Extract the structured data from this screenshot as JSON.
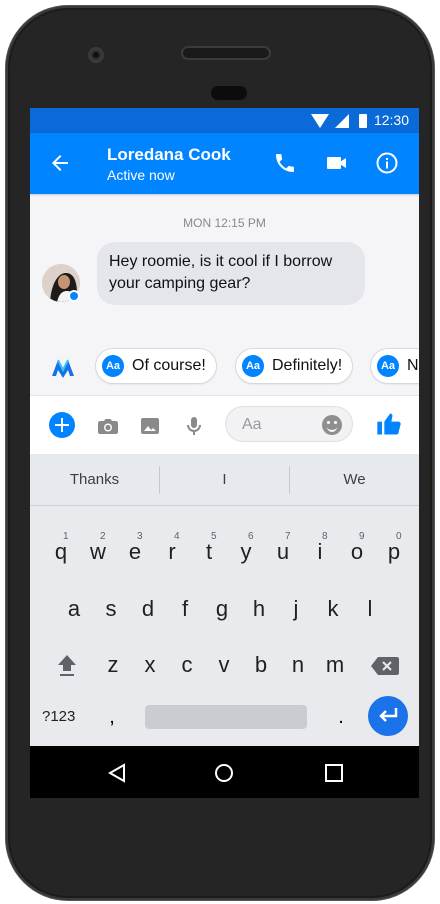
{
  "status_bar": {
    "time": "12:30"
  },
  "app_bar": {
    "contact_name": "Loredana Cook",
    "contact_status": "Active now",
    "icons": [
      "back-arrow-icon",
      "phone-call-icon",
      "video-call-icon",
      "info-icon"
    ]
  },
  "conversation": {
    "timestamp": "MON 12:15 PM",
    "messages": [
      {
        "text": "Hey roomie, is it cool if I borrow your camping gear?"
      }
    ]
  },
  "suggestions": {
    "items": [
      {
        "icon_label": "Aa",
        "text": "Of course!"
      },
      {
        "icon_label": "Aa",
        "text": "Definitely!"
      },
      {
        "icon_label": "Aa",
        "text": "N"
      }
    ]
  },
  "composer": {
    "placeholder": "Aa",
    "icons": [
      "add-icon",
      "camera-icon",
      "gallery-icon",
      "microphone-icon",
      "emoji-icon",
      "thumbs-up-icon"
    ]
  },
  "keyboard": {
    "predictions": [
      "Thanks",
      "I",
      "We"
    ],
    "rows": {
      "row1_letters": [
        "q",
        "w",
        "e",
        "r",
        "t",
        "y",
        "u",
        "i",
        "o",
        "p"
      ],
      "row1_numbers": [
        "1",
        "2",
        "3",
        "4",
        "5",
        "6",
        "7",
        "8",
        "9",
        "0"
      ],
      "row2_letters": [
        "a",
        "s",
        "d",
        "f",
        "g",
        "h",
        "j",
        "k",
        "l"
      ],
      "row3_letters": [
        "z",
        "x",
        "c",
        "v",
        "b",
        "n",
        "m"
      ],
      "mode_key": "?123",
      "comma_key": ",",
      "period_key": "."
    }
  },
  "navigation": {
    "icons": [
      "back-triangle-icon",
      "home-circle-icon",
      "recents-square-icon"
    ]
  }
}
